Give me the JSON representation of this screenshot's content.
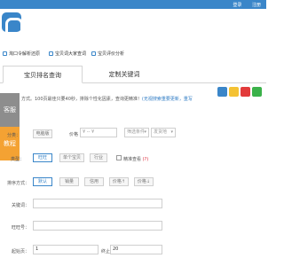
{
  "topbar": {
    "login": "登录",
    "register": "注册"
  },
  "toptabs": [
    {
      "label": "淘口令解析还原"
    },
    {
      "label": "宝贝词大家查词"
    },
    {
      "label": "宝贝评价分析"
    }
  ],
  "subtabs": {
    "active": "宝贝排名查询",
    "inactive": "定制关键词"
  },
  "side": {
    "service": "客服",
    "tutorial": "教程"
  },
  "note": {
    "text": "方式。100页最佳只要40秒，排除个性化因素，查询更精准！",
    "link": "(无视搜索重要更新，重写"
  },
  "form": {
    "row1": {
      "label": "分类：",
      "btn": "电脑版",
      "price_label": "价格",
      "price_sep": "¥ -- ¥",
      "filter": "筛选条件",
      "shipping": "发货地"
    },
    "row2": {
      "label": "类型：",
      "btn_selected": "旺旺",
      "btn2": "单个宝贝",
      "btn3": "行业",
      "check_label": "精准查看",
      "hint": "(?)"
    },
    "row3": {
      "label": "排序方式：",
      "btn_selected": "默认",
      "btn2": "销量",
      "btn3": "信用",
      "btn4": "价格↑",
      "btn5": "价格↓"
    },
    "keyword_label": "关键词：",
    "wangwang_label": "旺旺号：",
    "start_label": "起始页：",
    "start_value": "1",
    "end_label": "终止页：",
    "end_value": "20"
  },
  "colors": {
    "brand": "#3a86c9",
    "accent": "#f4a233",
    "side_gray": "#8d8d8d"
  }
}
